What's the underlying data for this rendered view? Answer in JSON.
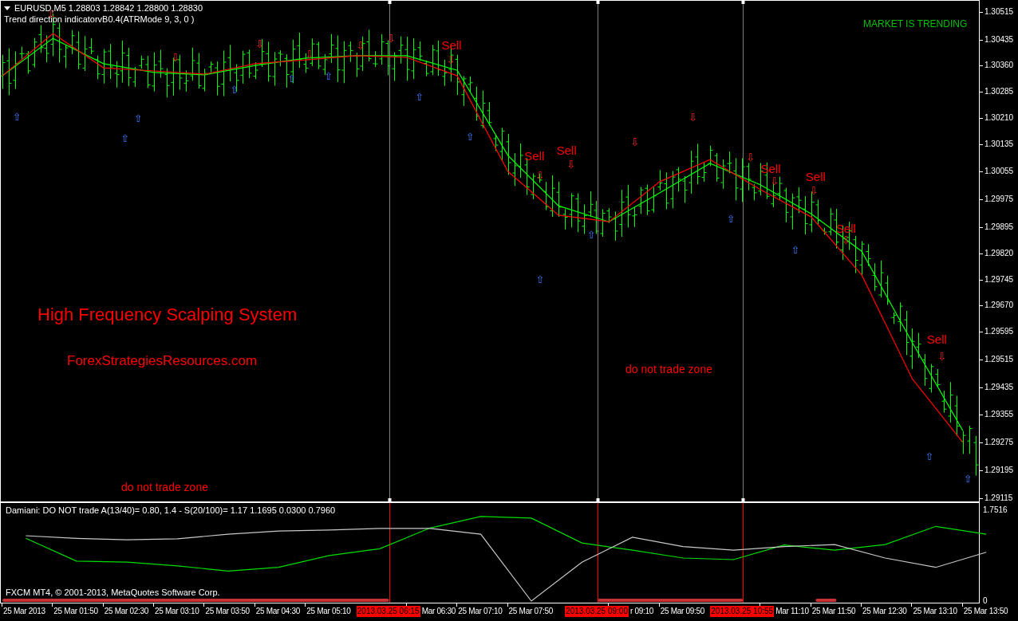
{
  "header": {
    "symbol_line": "EURUSD,M5  1.28803 1.28842 1.28800 1.28830",
    "indicator_line": "Trend direction indicatorvB0.4(ATRMode 9, 3, 0 )"
  },
  "overlay_labels": [
    {
      "kind": "status",
      "text": "MARKET IS TRENDING"
    },
    {
      "kind": "title",
      "text": "High Frequency Scalping System"
    },
    {
      "kind": "site",
      "text": "ForexStrategiesResources.com"
    },
    {
      "kind": "zone",
      "text": "do not trade zone"
    },
    {
      "kind": "zone",
      "text": "do not trade zone"
    }
  ],
  "price_chart": {
    "chart_data": {
      "type": "line",
      "ylim": [
        1.29106,
        1.30547
      ],
      "categories": [
        null,
        null,
        null,
        null,
        null,
        null,
        null,
        null,
        null,
        null,
        null,
        null,
        null,
        null,
        null,
        null,
        null,
        null,
        null,
        null
      ],
      "series": [
        {
          "color": "#00ff00",
          "values": [
            1.30331,
            1.30439,
            1.30366,
            1.30341,
            1.30334,
            1.30361,
            1.30382,
            1.30389,
            1.30389,
            1.30347,
            1.30102,
            1.29957,
            1.29911,
            1.29994,
            1.30079,
            1.30017,
            1.29934,
            1.29826,
            1.29563,
            1.2931
          ]
        },
        {
          "color": "#ff0000",
          "values": [
            1.30331,
            1.30453,
            1.30354,
            1.30345,
            1.30336,
            1.30366,
            1.30377,
            1.30389,
            1.30384,
            1.30331,
            1.30056,
            1.2993,
            1.29911,
            1.30026,
            1.3009,
            1.30003,
            1.29925,
            1.29758,
            1.29459,
            1.29276
          ]
        }
      ],
      "yticks": [
        {
          "value": 1.30515,
          "label": "1.30515"
        },
        {
          "value": 1.30435,
          "label": "1.30435"
        },
        {
          "value": 1.3036,
          "label": "1.30360"
        },
        {
          "value": 1.30285,
          "label": "1.30285"
        },
        {
          "value": 1.3021,
          "label": "1.30210"
        },
        {
          "value": 1.30135,
          "label": "1.30135"
        },
        {
          "value": 1.30055,
          "label": "1.30055"
        },
        {
          "value": 1.29975,
          "label": "1.29975"
        },
        {
          "value": 1.29895,
          "label": "1.29895"
        },
        {
          "value": 1.2982,
          "label": "1.29820"
        },
        {
          "value": 1.29745,
          "label": "1.29745"
        },
        {
          "value": 1.2967,
          "label": "1.29670"
        },
        {
          "value": 1.29595,
          "label": "1.29595"
        },
        {
          "value": 1.29515,
          "label": "1.29515"
        },
        {
          "value": 1.29435,
          "label": "1.29435"
        },
        {
          "value": 1.29355,
          "label": "1.29355"
        },
        {
          "value": 1.29275,
          "label": "1.29275"
        },
        {
          "value": 1.29195,
          "label": "1.29195"
        },
        {
          "value": 1.29115,
          "label": "1.29115"
        }
      ],
      "annotations": [
        "Sell",
        "Sell",
        "Sell",
        "Sell",
        "Sell",
        "Sell",
        "Sell",
        "⇩",
        "⇩",
        "⇩",
        "⇩",
        "⇩",
        "⇩",
        "⇩",
        "⇩",
        "⇩",
        "⇩",
        "⇩",
        "⇩",
        "⇩",
        "⇩",
        "⇩",
        "⇩",
        "⇧",
        "⇧",
        "⇧",
        "⇧",
        "⇧",
        "⇧",
        "⇧",
        "⇧",
        "⇧",
        "⇧",
        "⇧",
        "⇧",
        "⇧",
        "⇧"
      ]
    }
  },
  "time_markers": [
    {
      "label": "2013.03.25 06:15"
    },
    {
      "label": "2013.03.25 09:00"
    },
    {
      "label": "2013.03.25 10:55"
    }
  ],
  "indicator": {
    "label": "Damiani: DO NOT trade A(13/40)= 0.80, 1.4 - S(20/100)= 1.17  1.1695 0.0300 0.7960",
    "copyright": "FXCM MT4, © 2001-2013, MetaQuotes Software Corp.",
    "chart_data": {
      "type": "line",
      "ylim": [
        -0.03,
        1.89
      ],
      "yticks": [
        {
          "value": 1.7516,
          "label": "1.7516"
        },
        {
          "value": 0,
          "label": "0"
        }
      ],
      "categories": [
        "25 Mar 2013",
        "25 Mar 01:50",
        "25 Mar 02:30",
        "25 Mar 03:10",
        "25 Mar 03:50",
        "25 Mar 04:30",
        "25 Mar 05:10",
        null,
        "Mar 06:30",
        "25 Mar 07:10",
        "25 Mar 07:50",
        null,
        "r 09:10",
        "25 Mar 09:50",
        null,
        "Mar 11:10",
        "25 Mar 11:50",
        "25 Mar 12:30",
        "25 Mar 13:10",
        "25 Mar 13:50"
      ],
      "series": [
        {
          "color": "#00dd00",
          "values": [
            1.21,
            0.77,
            0.75,
            0.68,
            0.58,
            0.65,
            0.88,
            1.01,
            1.41,
            1.63,
            1.6,
            1.12,
            0.98,
            0.83,
            0.8,
            1.08,
            0.98,
            1.09,
            1.44,
            1.29
          ]
        },
        {
          "color": "#c8c8c8",
          "values": [
            1.26,
            1.21,
            1.18,
            1.2,
            1.29,
            1.35,
            1.37,
            1.4,
            1.4,
            1.29,
            0,
            0.75,
            1.23,
            1.05,
            0.98,
            1.05,
            1.09,
            0.83,
            0.65,
            0.94
          ]
        }
      ]
    }
  }
}
